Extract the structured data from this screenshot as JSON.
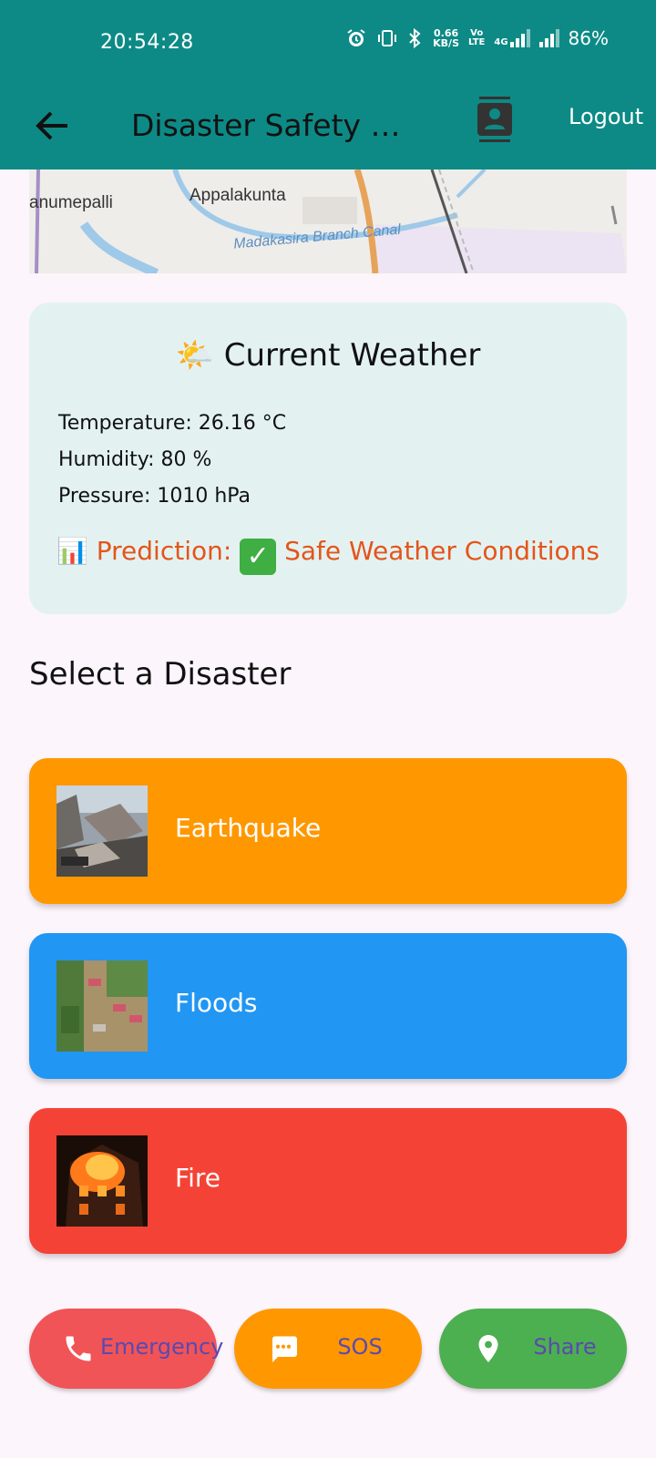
{
  "status_bar": {
    "time": "20:54:28",
    "net_speed_value": "0.66",
    "net_speed_unit": "KB/S",
    "volte_top": "Vo",
    "volte_bottom": "LTE",
    "network_type": "4G",
    "battery": "86%"
  },
  "app_bar": {
    "title": "Disaster Safety Management",
    "logout_label": "Logout"
  },
  "map": {
    "places": [
      "anumepalli",
      "Appalakunta"
    ],
    "waterway": "Madakasira Branch Canal"
  },
  "weather": {
    "icon": "🌤️",
    "title": "Current Weather",
    "temperature": "Temperature: 26.16 °C",
    "humidity": "Humidity: 80 %",
    "pressure": "Pressure: 1010 hPa",
    "prediction_icon": "📊",
    "prediction_label": "Prediction:",
    "prediction_value": "Safe Weather Conditions"
  },
  "section_title": "Select a Disaster",
  "disasters": [
    {
      "label": "Earthquake",
      "color": "#ff9800"
    },
    {
      "label": "Floods",
      "color": "#2196f3"
    },
    {
      "label": "Fire",
      "color": "#f44336"
    }
  ],
  "actions": [
    {
      "label": "Emergency",
      "icon": "phone-icon",
      "color": "#f15456"
    },
    {
      "label": "SOS",
      "icon": "message-icon",
      "color": "#ff9800"
    },
    {
      "label": "Share",
      "icon": "location-pin-icon",
      "color": "#4caf50"
    }
  ],
  "colors": {
    "app_bar": "#0d8a86",
    "background": "#fcf5fb",
    "weather_card": "#e3f2f1",
    "prediction_text": "#e5541a",
    "button_text": "#5a49b0"
  }
}
